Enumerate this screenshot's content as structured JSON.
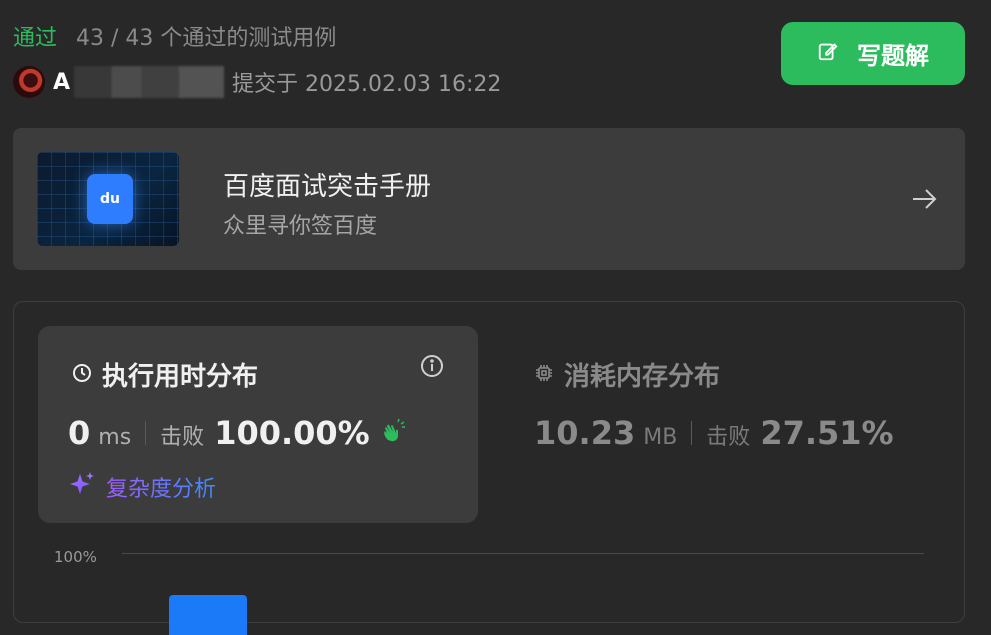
{
  "result": {
    "status": "通过",
    "cases": "43 / 43 个通过的测试用例"
  },
  "submission": {
    "user_initial": "A",
    "submitted_at": "提交于 2025.02.03 16:22"
  },
  "actions": {
    "write_solution": "写题解"
  },
  "banner": {
    "title": "百度面试突击手册",
    "subtitle": "众里寻你签百度",
    "logo_text": "du"
  },
  "runtime": {
    "title": "执行用时分布",
    "value": "0",
    "unit": "ms",
    "beats_label": "击败",
    "beats_value": "100.00%",
    "complexity_link": "复杂度分析"
  },
  "memory": {
    "title": "消耗内存分布",
    "value": "10.23",
    "unit": "MB",
    "beats_label": "击败",
    "beats_value": "27.51%"
  },
  "chart_data": {
    "type": "bar",
    "tick_labels": [
      "100%"
    ]
  },
  "colors": {
    "accent_green": "#2cbb5d",
    "bar_blue": "#1a7af8"
  }
}
